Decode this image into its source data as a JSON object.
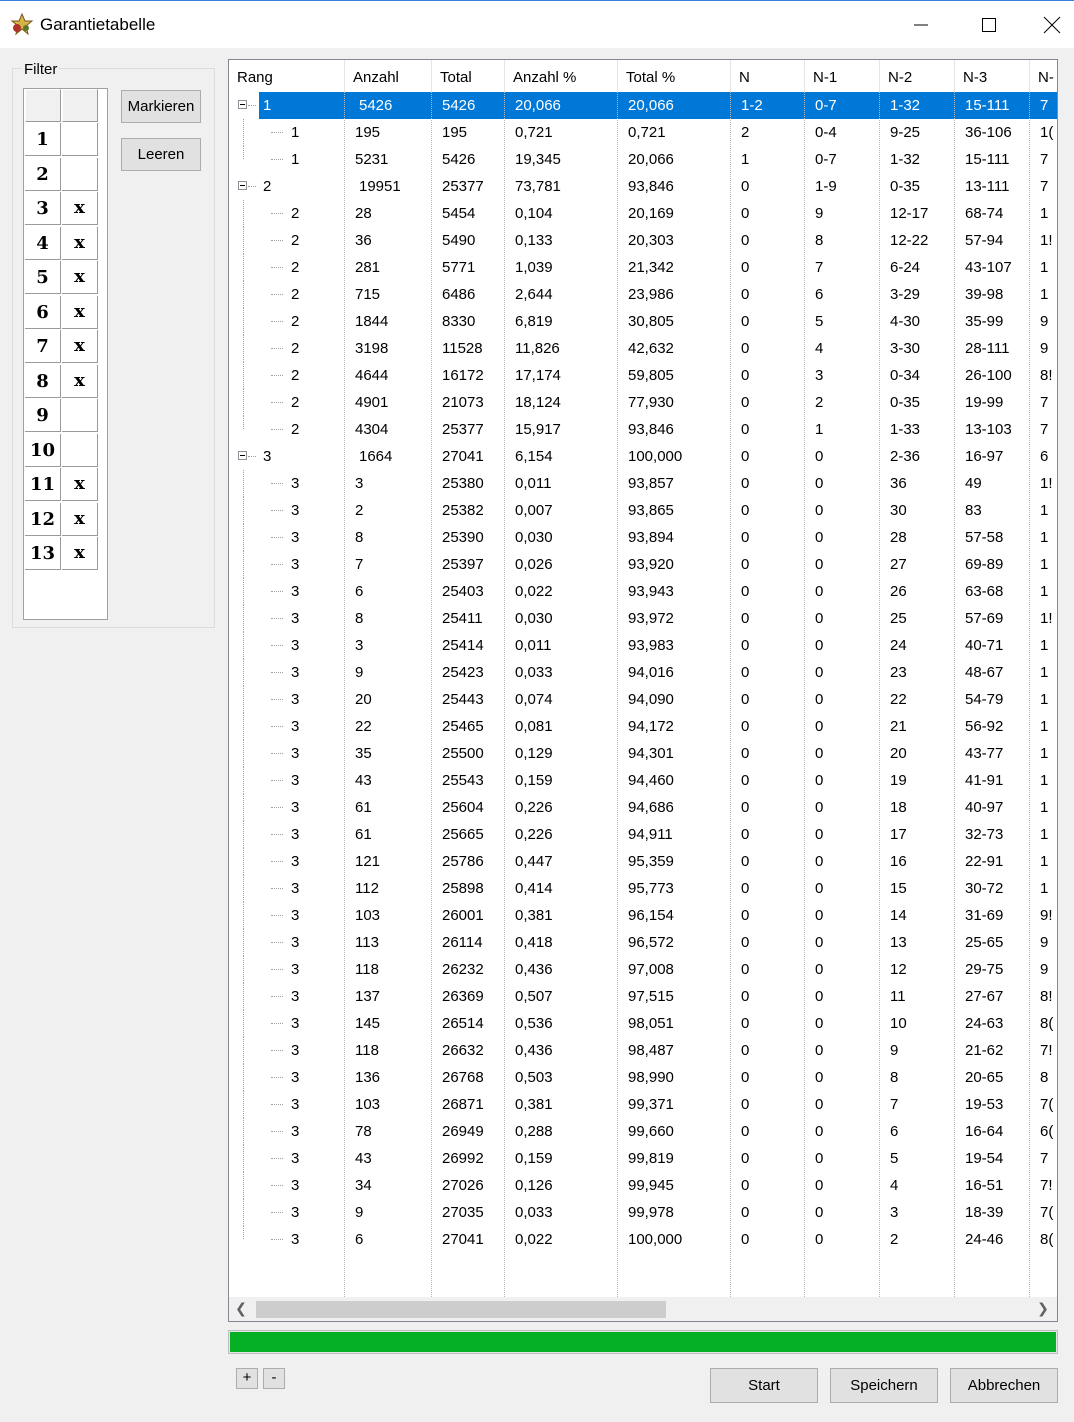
{
  "window": {
    "title": "Garantietabelle"
  },
  "filter": {
    "label": "Filter",
    "rows": [
      {
        "num": "1",
        "mark": ""
      },
      {
        "num": "2",
        "mark": ""
      },
      {
        "num": "3",
        "mark": "x"
      },
      {
        "num": "4",
        "mark": "x"
      },
      {
        "num": "5",
        "mark": "x"
      },
      {
        "num": "6",
        "mark": "x"
      },
      {
        "num": "7",
        "mark": "x"
      },
      {
        "num": "8",
        "mark": "x"
      },
      {
        "num": "9",
        "mark": ""
      },
      {
        "num": "10",
        "mark": ""
      },
      {
        "num": "11",
        "mark": "x"
      },
      {
        "num": "12",
        "mark": "x"
      },
      {
        "num": "13",
        "mark": "x"
      }
    ],
    "markieren_label": "Markieren",
    "leeren_label": "Leeren"
  },
  "table": {
    "columns": [
      "Rang",
      "Anzahl",
      "Total",
      "Anzahl %",
      "Total %",
      "N",
      "N-1",
      "N-2",
      "N-3",
      "N-"
    ],
    "rows": [
      {
        "level": 0,
        "expander": true,
        "selected": true,
        "cells": [
          "1",
          "5426",
          "5426",
          "20,066",
          "20,066",
          "1-2",
          "0-7",
          "1-32",
          "15-111",
          "7"
        ]
      },
      {
        "level": 1,
        "cells": [
          "1",
          "195",
          "195",
          "0,721",
          "0,721",
          "2",
          "0-4",
          "9-25",
          "36-106",
          "1("
        ]
      },
      {
        "level": 1,
        "last": true,
        "cells": [
          "1",
          "5231",
          "5426",
          "19,345",
          "20,066",
          "1",
          "0-7",
          "1-32",
          "15-111",
          "7"
        ]
      },
      {
        "level": 0,
        "expander": true,
        "cells": [
          "2",
          "19951",
          "25377",
          "73,781",
          "93,846",
          "0",
          "1-9",
          "0-35",
          "13-111",
          "7"
        ]
      },
      {
        "level": 1,
        "cells": [
          "2",
          "28",
          "5454",
          "0,104",
          "20,169",
          "0",
          "9",
          "12-17",
          "68-74",
          "1"
        ]
      },
      {
        "level": 1,
        "cells": [
          "2",
          "36",
          "5490",
          "0,133",
          "20,303",
          "0",
          "8",
          "12-22",
          "57-94",
          "1!"
        ]
      },
      {
        "level": 1,
        "cells": [
          "2",
          "281",
          "5771",
          "1,039",
          "21,342",
          "0",
          "7",
          "6-24",
          "43-107",
          "1"
        ]
      },
      {
        "level": 1,
        "cells": [
          "2",
          "715",
          "6486",
          "2,644",
          "23,986",
          "0",
          "6",
          "3-29",
          "39-98",
          "1"
        ]
      },
      {
        "level": 1,
        "cells": [
          "2",
          "1844",
          "8330",
          "6,819",
          "30,805",
          "0",
          "5",
          "4-30",
          "35-99",
          "9"
        ]
      },
      {
        "level": 1,
        "cells": [
          "2",
          "3198",
          "11528",
          "11,826",
          "42,632",
          "0",
          "4",
          "3-30",
          "28-111",
          "9"
        ]
      },
      {
        "level": 1,
        "cells": [
          "2",
          "4644",
          "16172",
          "17,174",
          "59,805",
          "0",
          "3",
          "0-34",
          "26-100",
          "8!"
        ]
      },
      {
        "level": 1,
        "cells": [
          "2",
          "4901",
          "21073",
          "18,124",
          "77,930",
          "0",
          "2",
          "0-35",
          "19-99",
          "7"
        ]
      },
      {
        "level": 1,
        "last": true,
        "cells": [
          "2",
          "4304",
          "25377",
          "15,917",
          "93,846",
          "0",
          "1",
          "1-33",
          "13-103",
          "7"
        ]
      },
      {
        "level": 0,
        "expander": true,
        "cells": [
          "3",
          "1664",
          "27041",
          "6,154",
          "100,000",
          "0",
          "0",
          "2-36",
          "16-97",
          "6"
        ]
      },
      {
        "level": 1,
        "cells": [
          "3",
          "3",
          "25380",
          "0,011",
          "93,857",
          "0",
          "0",
          "36",
          "49",
          "1!"
        ]
      },
      {
        "level": 1,
        "cells": [
          "3",
          "2",
          "25382",
          "0,007",
          "93,865",
          "0",
          "0",
          "30",
          "83",
          "1"
        ]
      },
      {
        "level": 1,
        "cells": [
          "3",
          "8",
          "25390",
          "0,030",
          "93,894",
          "0",
          "0",
          "28",
          "57-58",
          "1"
        ]
      },
      {
        "level": 1,
        "cells": [
          "3",
          "7",
          "25397",
          "0,026",
          "93,920",
          "0",
          "0",
          "27",
          "69-89",
          "1"
        ]
      },
      {
        "level": 1,
        "cells": [
          "3",
          "6",
          "25403",
          "0,022",
          "93,943",
          "0",
          "0",
          "26",
          "63-68",
          "1"
        ]
      },
      {
        "level": 1,
        "cells": [
          "3",
          "8",
          "25411",
          "0,030",
          "93,972",
          "0",
          "0",
          "25",
          "57-69",
          "1!"
        ]
      },
      {
        "level": 1,
        "cells": [
          "3",
          "3",
          "25414",
          "0,011",
          "93,983",
          "0",
          "0",
          "24",
          "40-71",
          "1"
        ]
      },
      {
        "level": 1,
        "cells": [
          "3",
          "9",
          "25423",
          "0,033",
          "94,016",
          "0",
          "0",
          "23",
          "48-67",
          "1"
        ]
      },
      {
        "level": 1,
        "cells": [
          "3",
          "20",
          "25443",
          "0,074",
          "94,090",
          "0",
          "0",
          "22",
          "54-79",
          "1"
        ]
      },
      {
        "level": 1,
        "cells": [
          "3",
          "22",
          "25465",
          "0,081",
          "94,172",
          "0",
          "0",
          "21",
          "56-92",
          "1"
        ]
      },
      {
        "level": 1,
        "cells": [
          "3",
          "35",
          "25500",
          "0,129",
          "94,301",
          "0",
          "0",
          "20",
          "43-77",
          "1"
        ]
      },
      {
        "level": 1,
        "cells": [
          "3",
          "43",
          "25543",
          "0,159",
          "94,460",
          "0",
          "0",
          "19",
          "41-91",
          "1"
        ]
      },
      {
        "level": 1,
        "cells": [
          "3",
          "61",
          "25604",
          "0,226",
          "94,686",
          "0",
          "0",
          "18",
          "40-97",
          "1"
        ]
      },
      {
        "level": 1,
        "cells": [
          "3",
          "61",
          "25665",
          "0,226",
          "94,911",
          "0",
          "0",
          "17",
          "32-73",
          "1"
        ]
      },
      {
        "level": 1,
        "cells": [
          "3",
          "121",
          "25786",
          "0,447",
          "95,359",
          "0",
          "0",
          "16",
          "22-91",
          "1"
        ]
      },
      {
        "level": 1,
        "cells": [
          "3",
          "112",
          "25898",
          "0,414",
          "95,773",
          "0",
          "0",
          "15",
          "30-72",
          "1"
        ]
      },
      {
        "level": 1,
        "cells": [
          "3",
          "103",
          "26001",
          "0,381",
          "96,154",
          "0",
          "0",
          "14",
          "31-69",
          "9!"
        ]
      },
      {
        "level": 1,
        "cells": [
          "3",
          "113",
          "26114",
          "0,418",
          "96,572",
          "0",
          "0",
          "13",
          "25-65",
          "9"
        ]
      },
      {
        "level": 1,
        "cells": [
          "3",
          "118",
          "26232",
          "0,436",
          "97,008",
          "0",
          "0",
          "12",
          "29-75",
          "9"
        ]
      },
      {
        "level": 1,
        "cells": [
          "3",
          "137",
          "26369",
          "0,507",
          "97,515",
          "0",
          "0",
          "11",
          "27-67",
          "8!"
        ]
      },
      {
        "level": 1,
        "cells": [
          "3",
          "145",
          "26514",
          "0,536",
          "98,051",
          "0",
          "0",
          "10",
          "24-63",
          "8("
        ]
      },
      {
        "level": 1,
        "cells": [
          "3",
          "118",
          "26632",
          "0,436",
          "98,487",
          "0",
          "0",
          "9",
          "21-62",
          "7!"
        ]
      },
      {
        "level": 1,
        "cells": [
          "3",
          "136",
          "26768",
          "0,503",
          "98,990",
          "0",
          "0",
          "8",
          "20-65",
          "8"
        ]
      },
      {
        "level": 1,
        "cells": [
          "3",
          "103",
          "26871",
          "0,381",
          "99,371",
          "0",
          "0",
          "7",
          "19-53",
          "7("
        ]
      },
      {
        "level": 1,
        "cells": [
          "3",
          "78",
          "26949",
          "0,288",
          "99,660",
          "0",
          "0",
          "6",
          "16-64",
          "6("
        ]
      },
      {
        "level": 1,
        "cells": [
          "3",
          "43",
          "26992",
          "0,159",
          "99,819",
          "0",
          "0",
          "5",
          "19-54",
          "7"
        ]
      },
      {
        "level": 1,
        "cells": [
          "3",
          "34",
          "27026",
          "0,126",
          "99,945",
          "0",
          "0",
          "4",
          "16-51",
          "7!"
        ]
      },
      {
        "level": 1,
        "cells": [
          "3",
          "9",
          "27035",
          "0,033",
          "99,978",
          "0",
          "0",
          "3",
          "18-39",
          "7("
        ]
      },
      {
        "level": 1,
        "last": true,
        "cells": [
          "3",
          "6",
          "27041",
          "0,022",
          "100,000",
          "0",
          "0",
          "2",
          "24-46",
          "8("
        ]
      }
    ]
  },
  "progress": {
    "value": 1.0,
    "color": "#06b025"
  },
  "footer": {
    "plus_label": "+",
    "minus_label": "-",
    "start_label": "Start",
    "speichern_label": "Speichern",
    "abbrechen_label": "Abbrechen"
  },
  "colors": {
    "selection": "#0078d7",
    "accent_green": "#06b025"
  }
}
